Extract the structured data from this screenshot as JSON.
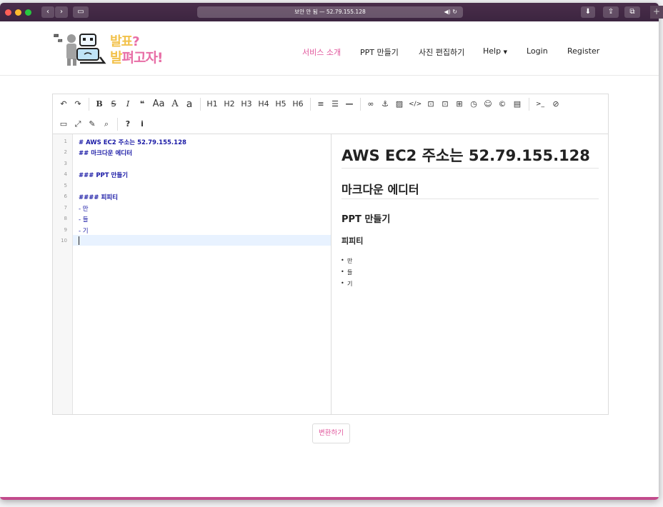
{
  "browser": {
    "url": "보안 안 됨 — 52.79.155.128",
    "colors": {
      "close": "#ff5f57",
      "minimize": "#febc2e",
      "zoom": "#28c840"
    }
  },
  "site": {
    "logo": {
      "line1_a": "발표",
      "line1_b": "?",
      "line2_a": "발",
      "line2_b": "펴고자!"
    },
    "nav": {
      "service": "서비스 소개",
      "ppt": "PPT 만들기",
      "photo": "사진 편집하기",
      "help": "Help",
      "login": "Login",
      "register": "Register"
    },
    "accent_color": "#e0559b"
  },
  "toolbar": {
    "row1": [
      "↶",
      "↷",
      "B",
      "S",
      "I",
      "❝",
      "Aa",
      "A",
      "a",
      "H1",
      "H2",
      "H3",
      "H4",
      "H5",
      "H6"
    ],
    "row2": [
      "≡",
      "☰",
      "—",
      "🔗",
      "⚓",
      "▨",
      "</>",
      "⊡",
      "⊡",
      "⊞",
      "◷",
      "☺",
      "©",
      "▤",
      ">_",
      "⊘"
    ],
    "row3": [
      "▭",
      "⤢",
      "✎",
      "⌕",
      "?",
      "i"
    ]
  },
  "editor": {
    "line_numbers": [
      "1",
      "2",
      "3",
      "4",
      "5",
      "6",
      "7",
      "8",
      "9",
      "10"
    ],
    "lines": [
      "# AWS EC2 주소는 52.79.155.128",
      "## 마크다운 에디터",
      "",
      "### PPT 만들기",
      "",
      "#### 피피티",
      "- 만",
      "- 들",
      "- 기",
      ""
    ]
  },
  "preview": {
    "h1": "AWS EC2 주소는 52.79.155.128",
    "h2": "마크다운 에디터",
    "h3": "PPT 만들기",
    "h4": "피피티",
    "items": [
      "만",
      "들",
      "기"
    ]
  },
  "convert_button": "변환하기"
}
